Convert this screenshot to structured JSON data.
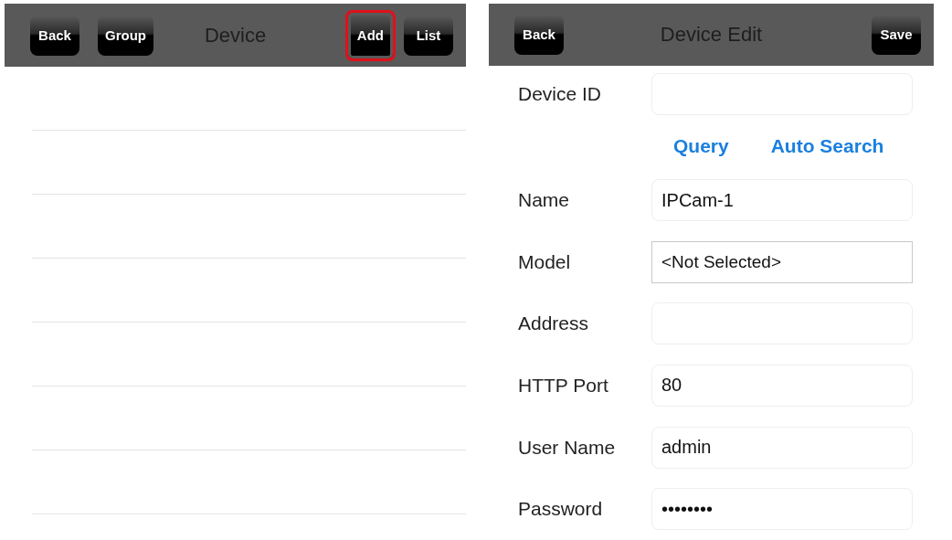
{
  "device_list": {
    "header": {
      "title": "Device",
      "left_buttons": [
        {
          "label": "Back",
          "highlighted": false
        },
        {
          "label": "Group",
          "highlighted": false
        }
      ],
      "right_buttons": [
        {
          "label": "Add",
          "highlighted": true
        },
        {
          "label": "List",
          "highlighted": false
        }
      ]
    }
  },
  "device_edit": {
    "header": {
      "title": "Device Edit",
      "left_buttons": [
        {
          "label": "Back",
          "highlighted": false
        }
      ],
      "right_buttons": [
        {
          "label": "Save",
          "highlighted": false
        }
      ]
    },
    "fields": [
      {
        "label": "Device ID",
        "kind": "text"
      },
      {
        "kind": "links",
        "links": [
          "Query",
          "Auto Search"
        ]
      },
      {
        "label": "Name",
        "kind": "text",
        "value": "IPCam-1"
      },
      {
        "label": "Model",
        "kind": "select",
        "value": "<Not Selected>"
      },
      {
        "label": "Address",
        "kind": "text"
      },
      {
        "label": "HTTP Port",
        "kind": "text",
        "value": "80"
      },
      {
        "label": "User Name",
        "kind": "text",
        "value": "admin"
      },
      {
        "label": "Password",
        "kind": "password",
        "value": "••••••••"
      }
    ]
  }
}
